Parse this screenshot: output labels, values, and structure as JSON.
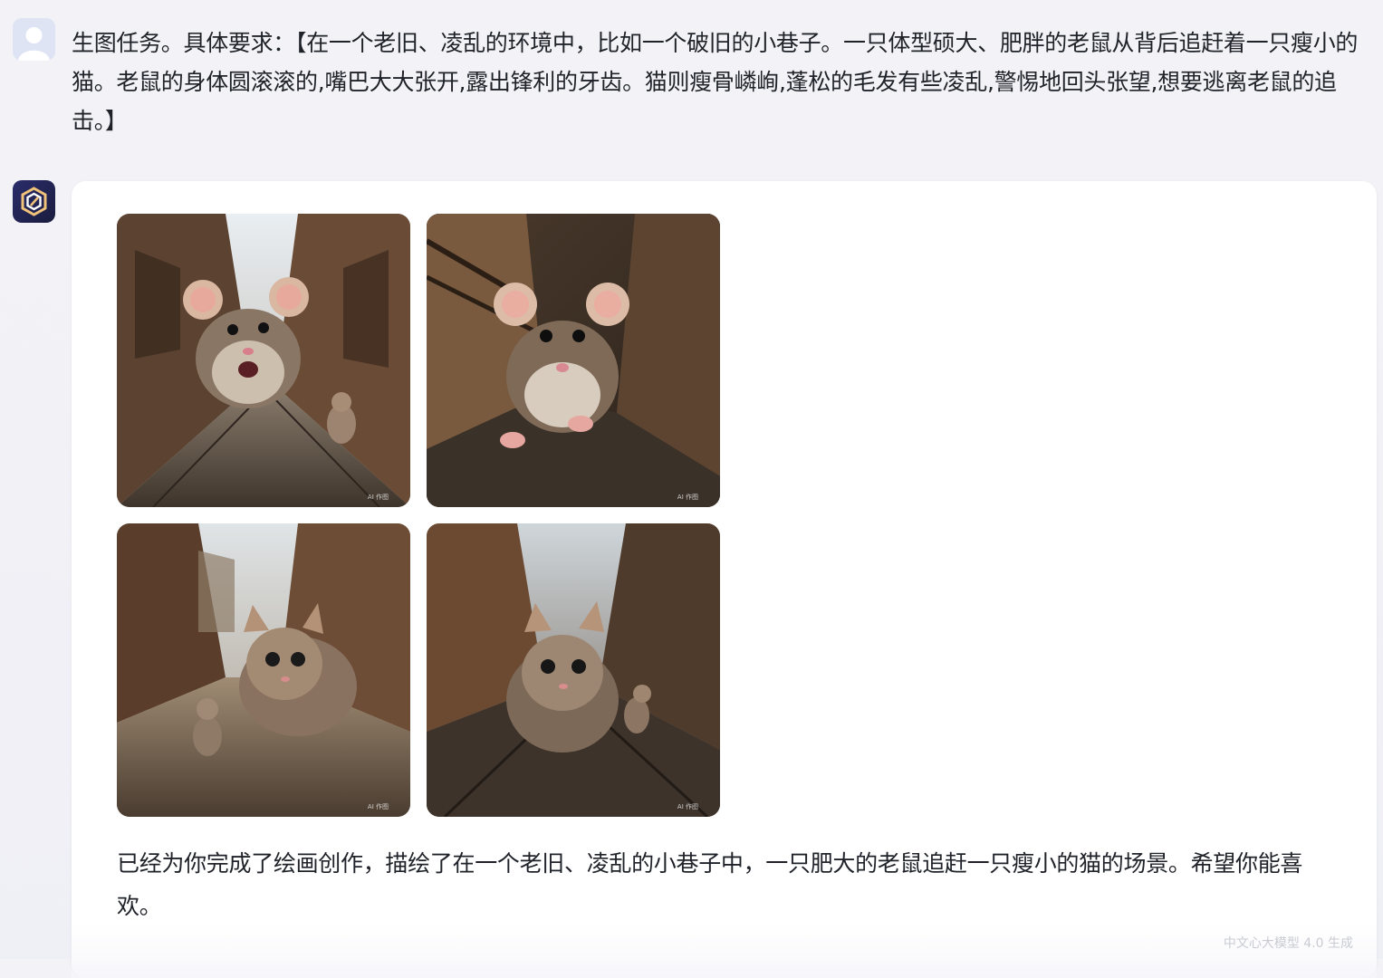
{
  "user_message": {
    "avatar_icon": "user-avatar-icon",
    "text": "生图任务。具体要求：【在一个老旧、凌乱的环境中，比如一个破旧的小巷子。一只体型硕大、肥胖的老鼠从背后追赶着一只瘦小的猫。老鼠的身体圆滚滚的,嘴巴大大张开,露出锋利的牙齿。猫则瘦骨嶙峋,蓬松的毛发有些凌乱,警惕地回头张望,想要逃离老鼠的追击。】"
  },
  "bot_message": {
    "avatar_icon": "bot-logo-icon",
    "images": [
      {
        "label": "generated-image-1",
        "watermark": "AI 作图"
      },
      {
        "label": "generated-image-2",
        "watermark": "AI 作图"
      },
      {
        "label": "generated-image-3",
        "watermark": "AI 作图"
      },
      {
        "label": "generated-image-4",
        "watermark": "AI 作图"
      }
    ],
    "reply_text": "已经为你完成了绘画创作，描绘了在一个老旧、凌乱的小巷子中，一只肥大的老鼠追赶一只瘦小的猫的场景。希望你能喜欢。",
    "model_note": "中文心大模型 4.0 生成"
  },
  "colors": {
    "page_background": "#f3f3f7",
    "card_background": "#ffffff",
    "text": "#1f2329",
    "bot_avatar": "#2a2d6b",
    "bot_logo_accent": "#f0c27a"
  }
}
